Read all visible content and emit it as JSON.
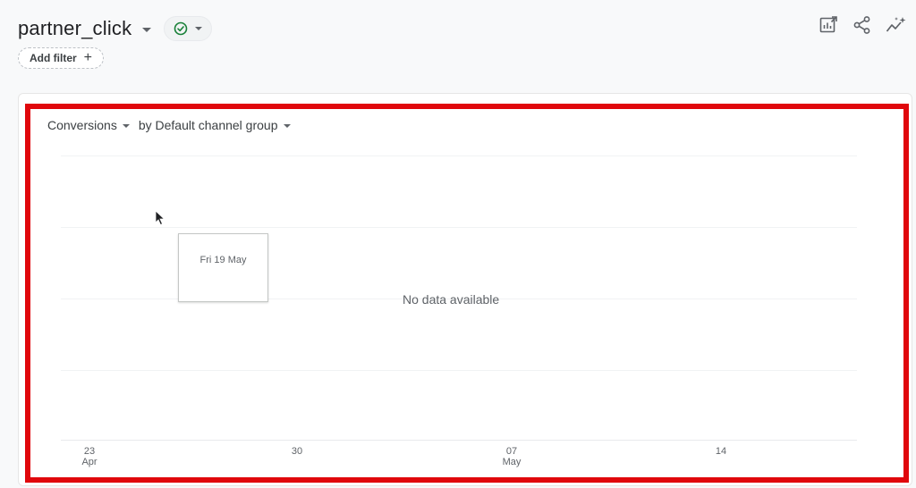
{
  "header": {
    "title": "partner_click",
    "add_filter_label": "Add filter"
  },
  "icons": {
    "status": "check-circle-icon",
    "customize": "edit-chart-icon",
    "share": "share-icon",
    "insights": "insights-sparkle-icon"
  },
  "colors": {
    "status_green": "#188038",
    "highlight_red": "#e0070c"
  },
  "chart": {
    "metric_label": "Conversions",
    "dimension_label": "by Default channel group",
    "empty_message": "No data available",
    "tooltip_date": "Fri 19 May",
    "x_ticks": [
      {
        "day": "23",
        "month": "Apr"
      },
      {
        "day": "30",
        "month": ""
      },
      {
        "day": "07",
        "month": "May"
      },
      {
        "day": "14",
        "month": ""
      }
    ]
  }
}
